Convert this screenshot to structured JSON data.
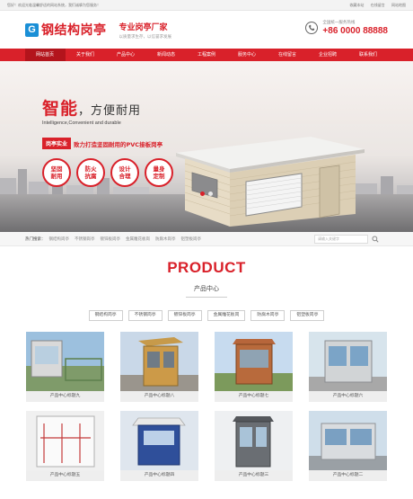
{
  "topbar": {
    "welcome": "您好！欢迎光临温馨舒适的网站系统，我们诚挚为您服务！",
    "links": [
      "收藏本站",
      "在线留言",
      "网站地图"
    ]
  },
  "header": {
    "logo_mark": "G",
    "logo_text": "钢结构岗亭",
    "slogan_main": "专业岗亭厂家",
    "slogan_sub": "以质量求生存，以信誉求发展",
    "hotline_label": "全国统一服务热线",
    "hotline_number": "+86 0000 88888"
  },
  "nav": [
    {
      "label": "网站首页",
      "active": true
    },
    {
      "label": "关于我们",
      "active": false
    },
    {
      "label": "产品中心",
      "active": false
    },
    {
      "label": "新闻动态",
      "active": false
    },
    {
      "label": "工程案例",
      "active": false
    },
    {
      "label": "服务中心",
      "active": false
    },
    {
      "label": "在线留言",
      "active": false
    },
    {
      "label": "企业招聘",
      "active": false
    },
    {
      "label": "联系我们",
      "active": false
    }
  ],
  "banner": {
    "title_strong": "智能",
    "title_rest": "，方便耐用",
    "subtitle_en_1": "Intelligence,Convenient and durable",
    "tag": "岗亭实业",
    "tagline": "致力打造坚固耐用的PVC接板岗亭",
    "features": [
      "坚固耐用",
      "防火抗腐",
      "设计合理",
      "量身定制"
    ],
    "slides": 2,
    "active_slide": 1
  },
  "hotbar": {
    "label": "热门搜索：",
    "items": [
      "钢结构岗亭",
      "不锈钢岗亭",
      "镀锌板岗亭",
      "金属雕花板岗",
      "防腐木岗亭",
      "铝塑板岗亭"
    ],
    "search_placeholder": "请输入关键字"
  },
  "product": {
    "title": "PRODUCT",
    "subtitle": "产品中心",
    "categories": [
      "钢结构岗亭",
      "不锈钢岗亭",
      "镀锌板岗亭",
      "金属雕花板岗",
      "防腐木岗亭",
      "铝塑板岗亭"
    ],
    "items": [
      {
        "caption": "产品中心标题九"
      },
      {
        "caption": "产品中心标题八"
      },
      {
        "caption": "产品中心标题七"
      },
      {
        "caption": "产品中心标题六"
      },
      {
        "caption": "产品中心标题五"
      },
      {
        "caption": "产品中心标题四"
      },
      {
        "caption": "产品中心标题三"
      },
      {
        "caption": "产品中心标题二"
      }
    ]
  },
  "colors": {
    "brand": "#d9212a",
    "brand_dark": "#b3141c"
  }
}
